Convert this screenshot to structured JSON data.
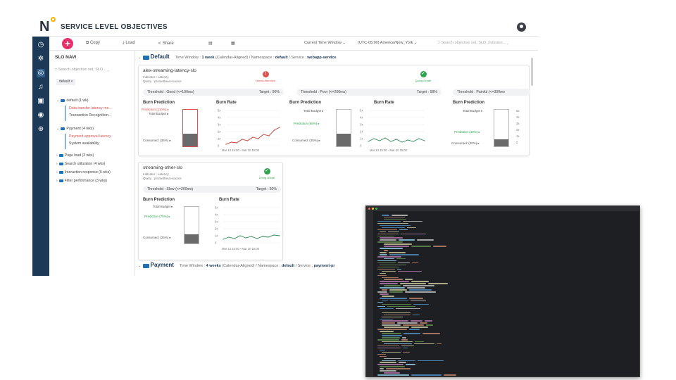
{
  "app": {
    "logo": "N",
    "title": "SERVICE LEVEL OBJECTIVES"
  },
  "toolbar": {
    "copy": "Copy",
    "load": "Load",
    "share": "Share",
    "time_window": "Current Time Window",
    "timezone": "(UTC-05:00) America/New_York",
    "search_placeholder": "Search objective set, SLO, indicator..."
  },
  "sidebar": {
    "title": "SLO NAVI",
    "search_placeholder": "Search objective set, SLO...",
    "chip": "default",
    "tree": [
      {
        "label": "default (1 wk)",
        "level": 0
      },
      {
        "label": "Data transfer latency me...",
        "level": 1,
        "alert": true
      },
      {
        "label": "Transaction Recognition...",
        "level": 1
      },
      {
        "label": "Payment (4 wks)",
        "level": 0
      },
      {
        "label": "Payment approval latency",
        "level": 1,
        "alert": true
      },
      {
        "label": "System availability",
        "level": 1
      },
      {
        "label": "Page load (3 wks)",
        "level": 0
      },
      {
        "label": "Search utilization (4 wks)",
        "level": 0
      },
      {
        "label": "Interaction response (6 wks)",
        "level": 0
      },
      {
        "label": "Filter performance (3 wks)",
        "level": 0
      }
    ]
  },
  "groups": [
    {
      "name": "Default",
      "time_window_label": "Time Window :",
      "time_window": "1 week",
      "calendar": "(Calendar-Aligned)",
      "namespace_label": "Namespace :",
      "namespace": "default",
      "service_label": "Service :",
      "service": "webapp-service"
    },
    {
      "name": "Payment",
      "time_window_label": "Time Window :",
      "time_window": "4 weeks",
      "calendar": "(Calendar-Aligned)",
      "namespace_label": "Namespace :",
      "namespace": "default",
      "service_label": "Service :",
      "service": "payment-pr"
    }
  ],
  "slo1": {
    "name": "alex-streaming-latency-slo",
    "indicator": "Indicator : Latency",
    "query": "Query : prometheus-source",
    "status_attention": "Needs Attention",
    "status_great": "Doing Great!",
    "thresholds": [
      {
        "label": "Threshold : Good (<=100ms)",
        "target": "Target : 90%"
      },
      {
        "label": "Threshold : Poor (<=200ms)",
        "target": "Target : 99%"
      },
      {
        "label": "Threshold : Painful (<=300ms",
        "target": ""
      }
    ]
  },
  "slo2": {
    "name": "streaming-other-slo",
    "indicator": "Indicator : Latency",
    "query": "Query : prometheus-source",
    "status": "Doing Great!",
    "threshold": "Threshold : Slow (<=200ms)",
    "target": "Target : 50%"
  },
  "chart_labels": {
    "burn_prediction": "Burn Prediction",
    "burn_rate": "Burn Rate",
    "total_budget": "Total Budget ▸",
    "date_range": "Mar 13 15:00 - Mar 20 15:00",
    "yticks": [
      "5x",
      "4x",
      "3x",
      "2x",
      "1x",
      "0"
    ]
  },
  "chart_data": [
    {
      "type": "bar",
      "title": "Burn Prediction",
      "labels": [
        "Prediction (110%) ▸",
        "Consumed: (35%) ▸"
      ],
      "prediction": 110,
      "consumed": 35
    },
    {
      "type": "bar",
      "title": "Burn Prediction",
      "labels": [
        "Prediction (65%) ▸",
        "Consumed: (35%) ▸"
      ],
      "prediction": 65,
      "consumed": 35
    },
    {
      "type": "bar",
      "title": "Burn Prediction",
      "labels": [
        "Prediction (48%) ▸",
        "Consumed: (20%) ▸"
      ],
      "prediction": 48,
      "consumed": 20
    },
    {
      "type": "bar",
      "title": "Burn Prediction",
      "labels": [
        "Prediction (75%) ▸",
        "Consumed: (25%) ▸"
      ],
      "prediction": 75,
      "consumed": 25
    },
    {
      "type": "line",
      "title": "Burn Rate",
      "ylim": [
        0,
        5
      ],
      "values": [
        0.2,
        0.5,
        0.4,
        0.9,
        0.7,
        1.2,
        1.0,
        1.6,
        1.4,
        2.2,
        2.6
      ]
    },
    {
      "type": "line",
      "title": "Burn Rate",
      "ylim": [
        0,
        5
      ],
      "values": [
        0.6,
        1.0,
        0.7,
        1.1,
        0.6,
        0.9,
        0.5,
        0.8,
        0.6,
        1.0,
        0.7
      ]
    },
    {
      "type": "line",
      "title": "Burn Rate",
      "ylim": [
        0,
        5
      ],
      "values": [
        0.5,
        0.8,
        0.6,
        1.0,
        0.7,
        0.9,
        0.6,
        0.9,
        0.8,
        1.1,
        1.0
      ]
    }
  ],
  "colors": {
    "nav": "#1c3a57",
    "accent": "#e8306a",
    "danger": "#d9534f",
    "success": "#2ea44f",
    "line_bad": "#c0392b",
    "line_good": "#2e8b57"
  }
}
